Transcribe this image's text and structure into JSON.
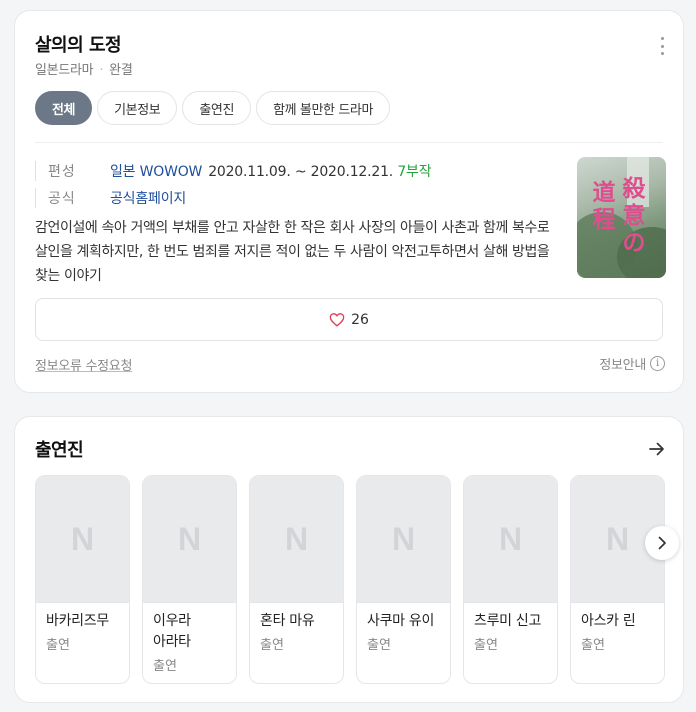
{
  "drama": {
    "title": "살의의 도정",
    "category": "일본드라마",
    "status": "완결"
  },
  "tabs": [
    {
      "label": "전체",
      "active": true
    },
    {
      "label": "기본정보",
      "active": false
    },
    {
      "label": "출연진",
      "active": false
    },
    {
      "label": "함께 볼만한 드라마",
      "active": false
    }
  ],
  "info": {
    "broadcast_label": "편성",
    "network": "일본 WOWOW",
    "dates": "2020.11.09. ~ 2020.12.21.",
    "episodes": "7부작",
    "official_label": "공식",
    "official_link": "공식홈페이지"
  },
  "synopsis": "감언이설에 속아 거액의 부채를 안고 자살한 한 작은 회사 사장의 아들이 사촌과 함께 복수로 살인을 계획하지만, 한 번도 범죄를 저지른 적이 없는 두 사람이 악전고투하면서 살해 방법을 찾는 이야기",
  "poster": {
    "col1": "殺意の",
    "col2": "道程"
  },
  "likes": {
    "count": "26"
  },
  "footer": {
    "report_link": "정보오류 수정요청",
    "guide": "정보안내"
  },
  "cast": {
    "title": "출연진",
    "placeholder": "N",
    "members": [
      {
        "name": "바카리즈무",
        "role": "출연"
      },
      {
        "name": "이우라 아라타",
        "role": "출연"
      },
      {
        "name": "혼타 마유",
        "role": "출연"
      },
      {
        "name": "사쿠마 유이",
        "role": "출연"
      },
      {
        "name": "츠루미 신고",
        "role": "출연"
      },
      {
        "name": "아스카 린",
        "role": "출연"
      }
    ]
  },
  "colors": {
    "active_tab": "#6c7887",
    "link": "#1f4e9b",
    "episodes": "#22a33a",
    "heart": "#e04058",
    "poster_text": "#e04d8f"
  },
  "icons": [
    "more-vertical-icon",
    "heart-icon",
    "info-icon",
    "arrow-right-icon",
    "chevron-right-icon"
  ]
}
